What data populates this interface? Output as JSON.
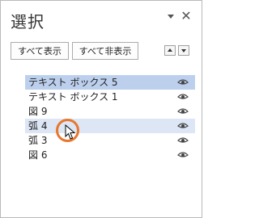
{
  "pane": {
    "title": "選択",
    "show_all_label": "すべて表示",
    "hide_all_label": "すべて非表示"
  },
  "items": [
    {
      "label": "テキスト ボックス 5",
      "state": "selected"
    },
    {
      "label": "テキスト ボックス 1",
      "state": "normal"
    },
    {
      "label": "図 9",
      "state": "normal"
    },
    {
      "label": "弧 4",
      "state": "hover"
    },
    {
      "label": "弧 3",
      "state": "normal"
    },
    {
      "label": "図 6",
      "state": "normal"
    }
  ],
  "icons": {
    "visibility": "eye-icon",
    "close": "close-icon",
    "menu": "chevron-down-icon",
    "reorder_up": "arrow-up-icon",
    "reorder_down": "arrow-down-icon"
  },
  "colors": {
    "selected_row": "#bcd0ee",
    "hover_row": "#dde6f5",
    "cursor_highlight": "#e8772e"
  }
}
